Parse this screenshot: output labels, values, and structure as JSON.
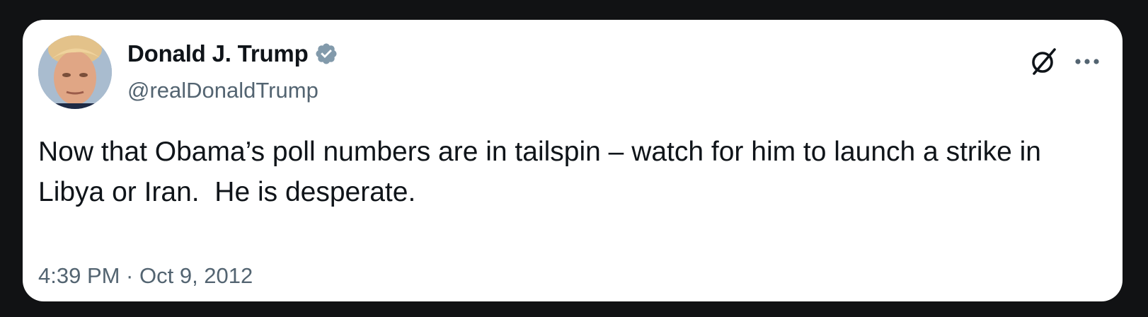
{
  "tweet": {
    "author": {
      "display_name": "Donald J. Trump",
      "handle": "@realDonaldTrump",
      "verified": true,
      "verified_badge_color": "#829aab"
    },
    "text": "Now that Obama’s poll numbers are in tailspin – watch for him to launch a strike in Libya or Iran.  He is desperate.",
    "timestamp": "4:39 PM · Oct 9, 2012"
  },
  "icons": {
    "grok": "grok-icon",
    "more": "more-options-icon",
    "verified": "verified-badge-icon"
  },
  "colors": {
    "page_background": "#111214",
    "card_background": "#ffffff",
    "primary_text": "#0f1419",
    "secondary_text": "#536471"
  }
}
